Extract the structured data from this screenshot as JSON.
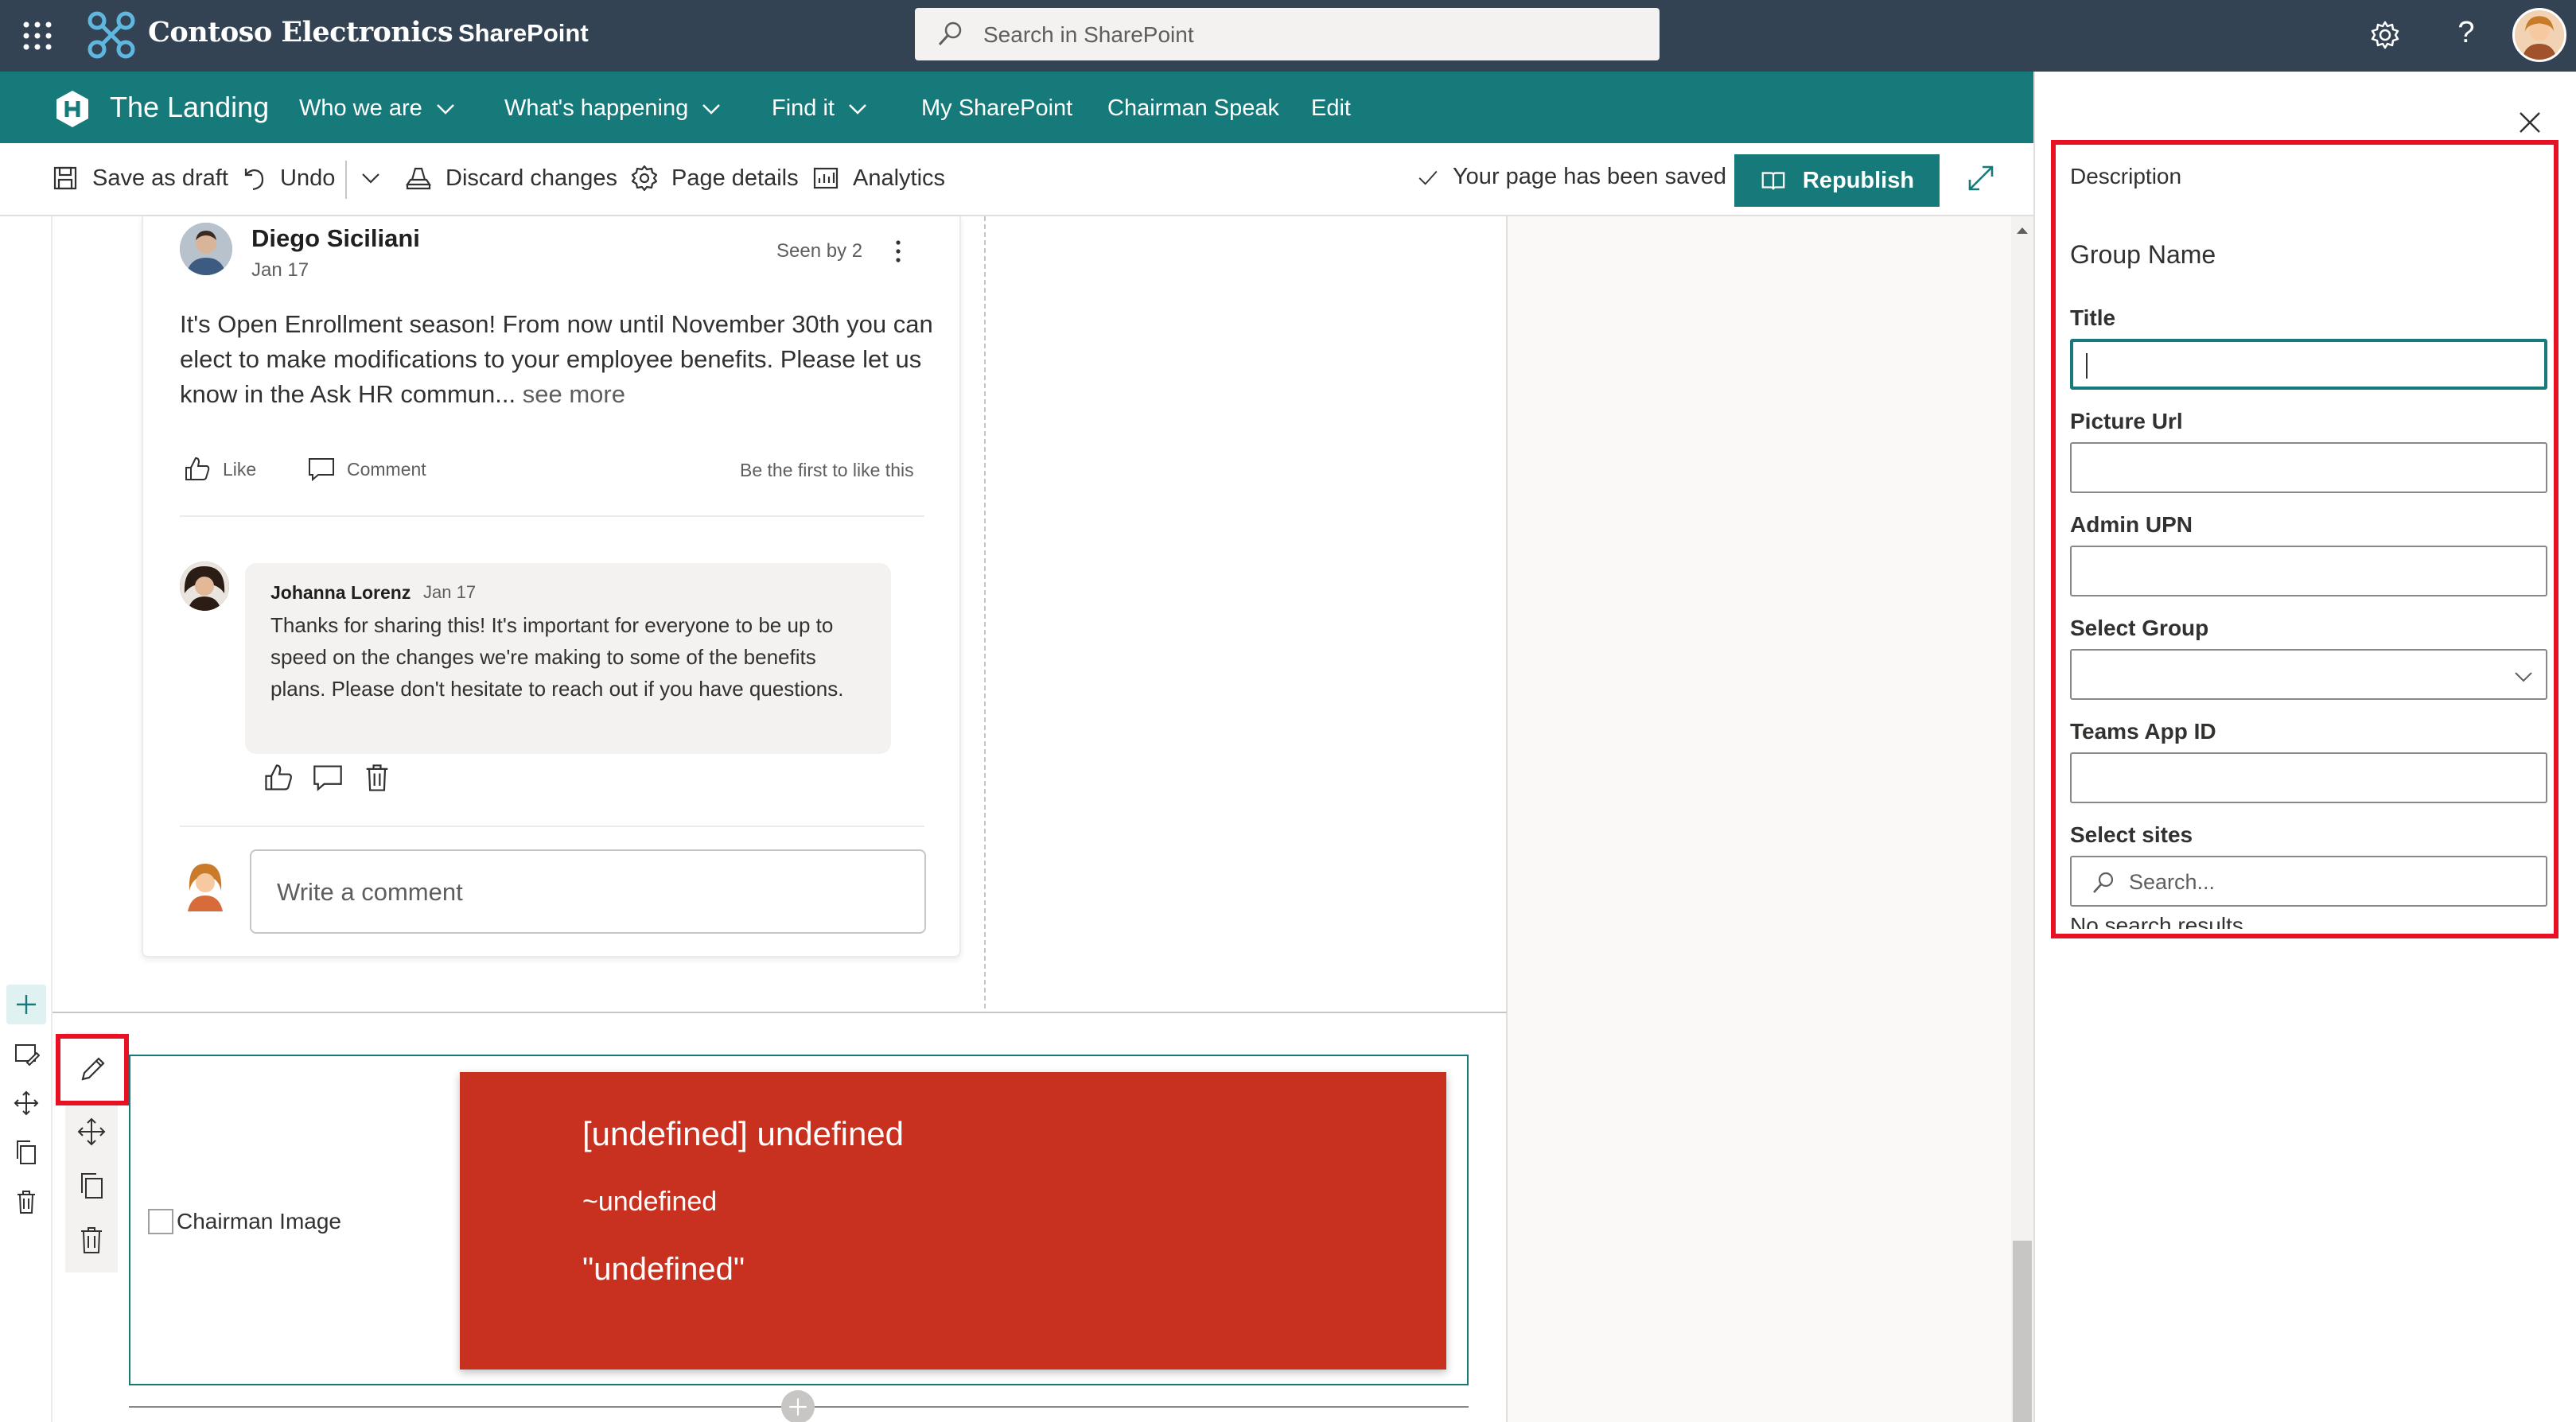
{
  "suite": {
    "org_name": "Contoso Electronics",
    "app_name": "SharePoint",
    "search_placeholder": "Search in SharePoint"
  },
  "hub": {
    "site_title": "The Landing",
    "nav": [
      "Who we are",
      "What's happening",
      "Find it",
      "My SharePoint",
      "Chairman Speak",
      "Edit"
    ]
  },
  "command_bar": {
    "save_draft": "Save as draft",
    "undo": "Undo",
    "discard": "Discard changes",
    "page_details": "Page details",
    "analytics": "Analytics",
    "status": "Your page has been saved",
    "republish": "Republish"
  },
  "post": {
    "author": "Diego Siciliani",
    "date": "Jan 17",
    "seen_by": "Seen by 2",
    "body": "It's Open Enrollment season! From now until November 30th you can elect to make modifications to your employee benefits. Please let us know in the Ask HR commun...",
    "see_more": "see more",
    "like": "Like",
    "comment": "Comment",
    "first_like": "Be the first to like this",
    "reply": {
      "author": "Johanna Lorenz",
      "date": "Jan 17",
      "text": "Thanks for sharing this! It's important for everyone to be up to speed on the changes we're making to some of the benefits plans. Please don't hesitate to reach out if you have questions."
    },
    "write_comment_placeholder": "Write a comment"
  },
  "chairman": {
    "image_alt": "Chairman Image",
    "line1": "[undefined] undefined",
    "line2": "~undefined",
    "line3": "\"undefined\""
  },
  "property_pane": {
    "description": "Description",
    "group_name": "Group Name",
    "fields": {
      "title": "Title",
      "picture_url": "Picture Url",
      "admin_upn": "Admin UPN",
      "select_group": "Select Group",
      "teams_app_id": "Teams App ID",
      "select_sites": "Select sites"
    },
    "sites_search_placeholder": "Search...",
    "no_results": "No search results"
  },
  "colors": {
    "suite_bar": "#334354",
    "hub_nav": "#177a7a",
    "accent": "#177a7a",
    "chairman_box": "#c8311f",
    "highlight": "#e81123"
  }
}
